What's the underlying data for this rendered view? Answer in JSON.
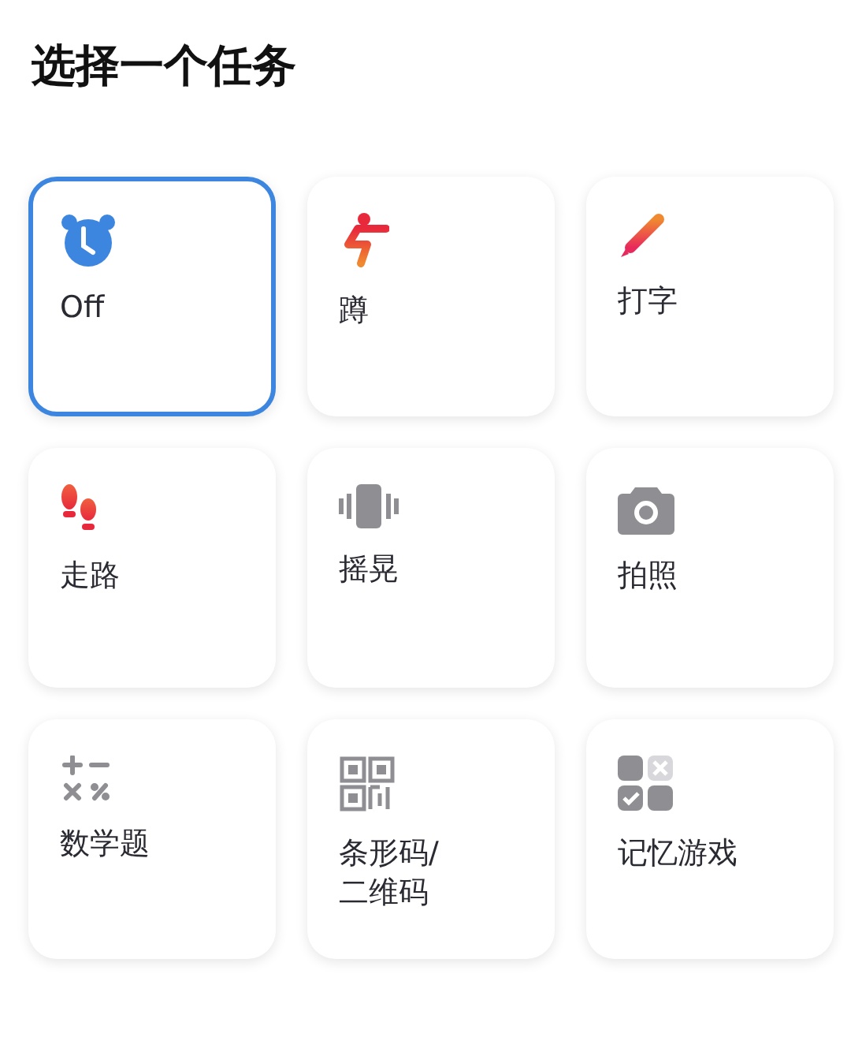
{
  "title": "选择一个任务",
  "tasks": [
    {
      "label": "Off",
      "selected": true
    },
    {
      "label": "蹲",
      "selected": false
    },
    {
      "label": "打字",
      "selected": false
    },
    {
      "label": "走路",
      "selected": false
    },
    {
      "label": "摇晃",
      "selected": false
    },
    {
      "label": "拍照",
      "selected": false
    },
    {
      "label": "数学题",
      "selected": false
    },
    {
      "label": "条形码/\n二维码",
      "selected": false
    },
    {
      "label": "记忆游戏",
      "selected": false
    }
  ]
}
